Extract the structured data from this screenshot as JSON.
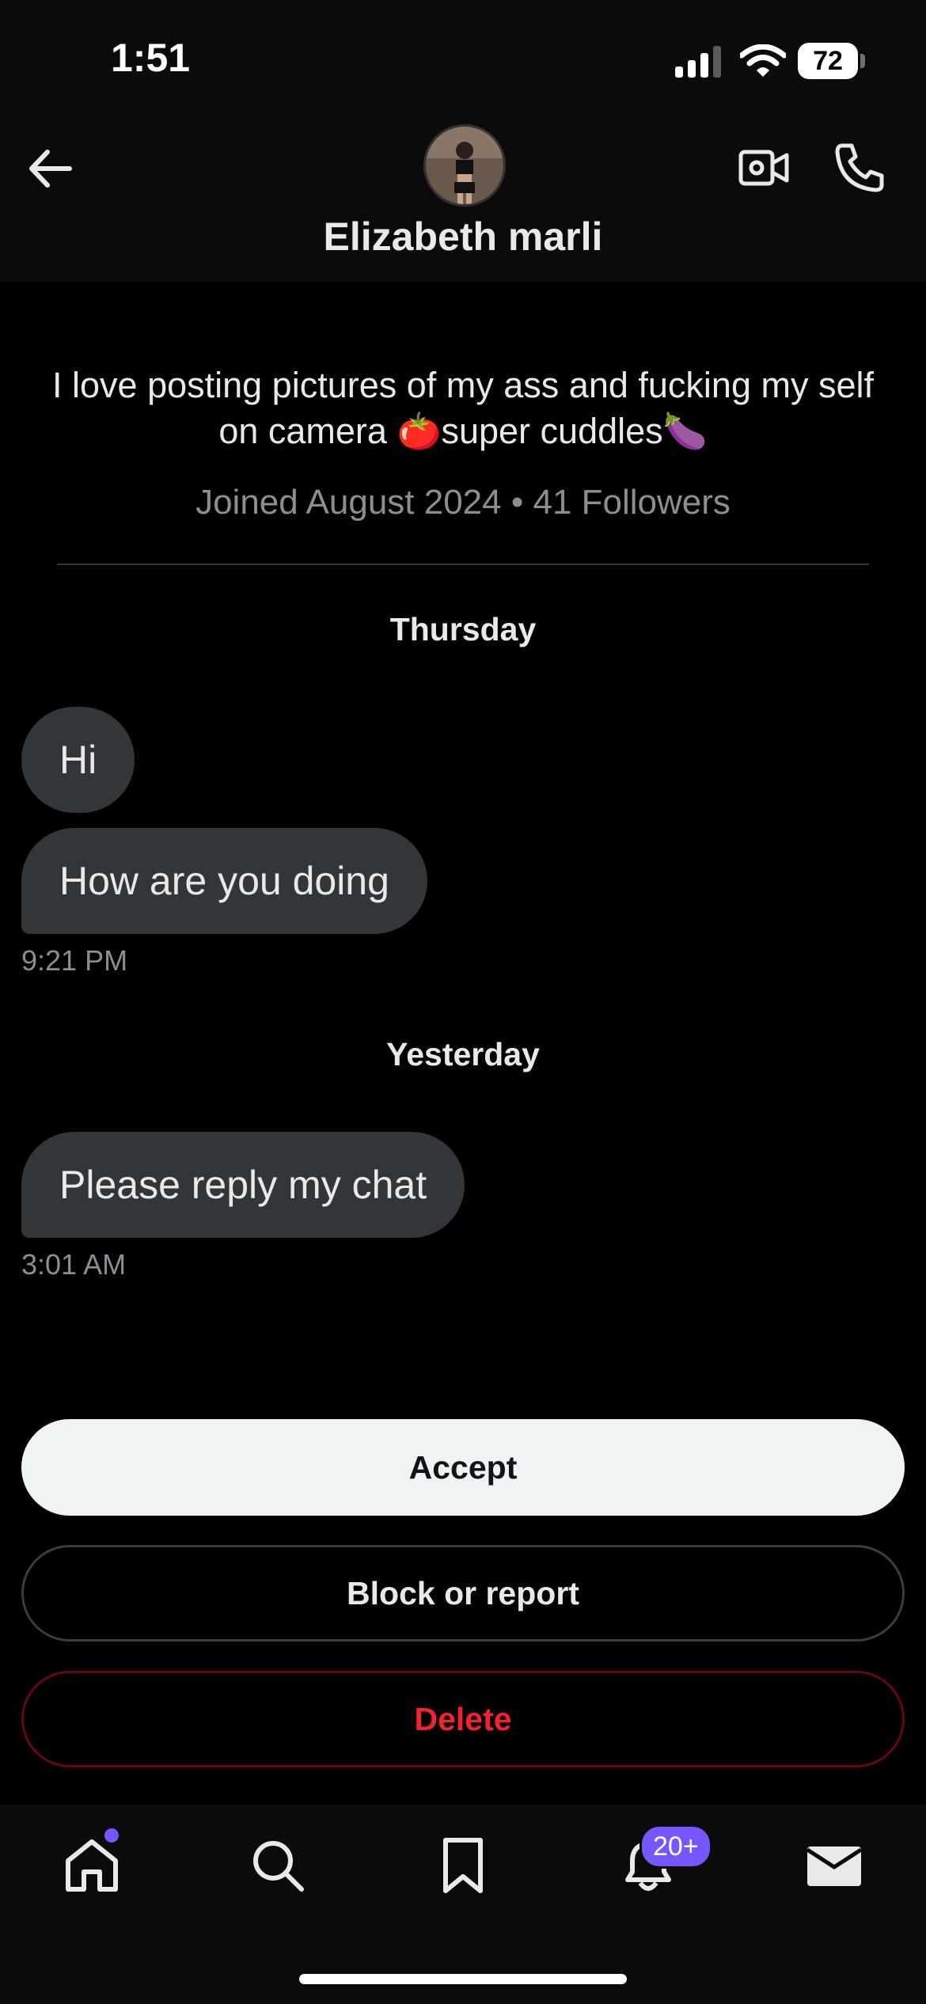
{
  "status_bar": {
    "time": "1:51",
    "battery": "72"
  },
  "header": {
    "contact_name": "Elizabeth marli"
  },
  "profile": {
    "bio": "I love posting pictures of my ass and fucking my self on camera 🍅super cuddles🍆",
    "meta": "Joined August 2024 • 41 Followers"
  },
  "conversation": [
    {
      "day": "Thursday",
      "messages": [
        "Hi",
        "How are you doing"
      ],
      "timestamp": "9:21 PM"
    },
    {
      "day": "Yesterday",
      "messages": [
        "Please reply my chat"
      ],
      "timestamp": "3:01 AM"
    }
  ],
  "actions": {
    "accept": "Accept",
    "block_or_report": "Block or report",
    "delete": "Delete"
  },
  "bottom_nav": {
    "items": [
      "home-icon",
      "search-icon",
      "bookmark-icon",
      "notifications-icon",
      "messages-icon"
    ],
    "notifications_badge": "20+"
  },
  "colors": {
    "accent": "#7856ff",
    "danger": "#f4212e",
    "bubble": "#333639"
  }
}
